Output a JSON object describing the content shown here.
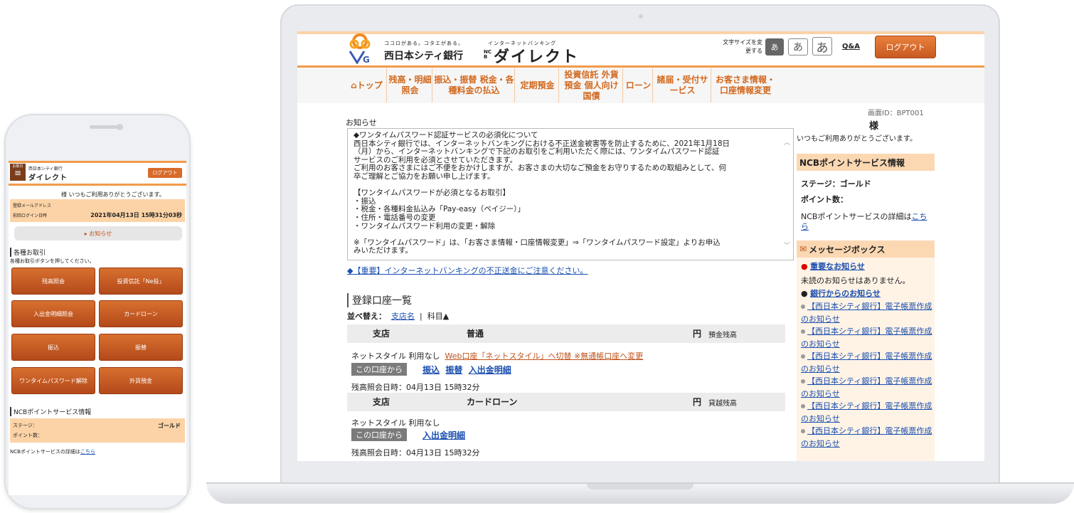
{
  "phone": {
    "logo_small": "西日本シティ銀行",
    "logo_main": "ダイレクト",
    "menu_label": "お取引",
    "logout": "ログアウト",
    "greeting": "様 いつもご利用ありがとうございます。",
    "email_label": "登録メールアドレス",
    "last_login_label": "前回ログイン日時",
    "last_login_value": "2021年04月13日 15時31分03秒",
    "notice_btn": "お知らせ",
    "section_title": "各種お取引",
    "section_sub": "各種お取引ボタンを押してください。",
    "buttons": [
      "残高照会",
      "投資信託「Ne投」",
      "入出金明細照会",
      "カードローン",
      "振込",
      "振替",
      "ワンタイムパスワード解除",
      "外貨預金"
    ],
    "ncb_title": "NCBポイントサービス情報",
    "stage_label": "ステージ：",
    "stage_value": "ゴールド",
    "points_label": "ポイント数：",
    "ncb_detail": "NCBポイントサービスの詳細は",
    "ncb_link": "こちら"
  },
  "desktop": {
    "tagline": "ココロがある。コタエがある。",
    "tagline2": "インターネットバンキング",
    "bank_name": "西日本シティ銀行",
    "ncb": "NCB",
    "direct": "ダイレクト",
    "font_size_label": "文字サイズを変更する",
    "font_a1": "あ",
    "font_a2": "あ",
    "font_a3": "あ",
    "qa": "Q&A",
    "logout": "ログアウト",
    "nav": [
      "トップ",
      "残高・明細照会",
      "振込・振替 税金・各種料金の払込",
      "定期預金",
      "投資信託 外貨預金 個人向け国債",
      "ローン",
      "諸届・受付サービス",
      "お客さま情報・口座情報変更"
    ],
    "screen_id": "画面ID：BPT001",
    "sama": "様",
    "thanks": "いつもご利用ありがとうございます。",
    "notice_label": "お知らせ",
    "notice_lines": [
      "◆ワンタイムパスワード認証サービスの必須化について",
      "西日本シティ銀行では、インターネットバンキングにおける不正送金被害等を防止するために、2021年1月18日",
      "（月）から、インターネットバンキングで下記のお取引をご利用いただく際には、ワンタイムパスワード認証",
      "サービスのご利用を必須とさせていただきます。",
      "ご利用のお客さまにはご不便をおかけしますが、お客さまの大切なご預金をお守りするための取組みとして、何",
      "卒ご理解とご協力をお願い申し上げます。",
      "",
      "【ワンタイムパスワードが必須となるお取引】",
      "・振込",
      "・税金・各種料金払込み「Pay-easy（ペイジー）」",
      "・住所・電話番号の変更",
      "・ワンタイムパスワード利用の変更・解除",
      "",
      "※「ワンタイムパスワード」は、「お客さま情報・口座情報変更」⇒「ワンタイムパスワード設定」よりお申込",
      "みいただけます。"
    ],
    "important_link": "◆【重要】インターネットバンキングの不正送金にご注意ください。",
    "accounts_title": "登録口座一覧",
    "sort_label": "並べ替え：",
    "sort_branch": "支店名",
    "sort_type": "科目▲",
    "accounts": [
      {
        "branch": "支店",
        "type": "普通",
        "yen": "円",
        "bal_label": "預金残高",
        "line1": "ネットスタイル 利用なし",
        "web_link": "Web口座「ネットスタイル」へ切替 ※無通帳口座へ変更",
        "tag": "この口座から",
        "actions": [
          "振込",
          "振替",
          "入出金明細"
        ],
        "time": "残高照会日時：04月13日 15時32分"
      },
      {
        "branch": "支店",
        "type": "カードローン",
        "yen": "円",
        "bal_label": "貸越残高",
        "line1": "ネットスタイル 利用なし",
        "web_link": "",
        "tag": "この口座から",
        "actions": [
          "入出金明細"
        ],
        "time": "残高照会日時：04月13日 15時32分"
      }
    ],
    "ncb_title": "NCBポイントサービス情報",
    "stage_label": "ステージ：ゴールド",
    "points_label": "ポイント数：",
    "ncb_detail": "NCBポイントサービスの詳細は",
    "ncb_link1": "こち",
    "ncb_link2": "ら",
    "msg_title": "メッセージボックス",
    "important_notice": "重要なお知らせ",
    "no_unread": "未読のお知らせはありません。",
    "bank_notice": "銀行からのお知らせ",
    "notices": [
      "【西日本シティ銀行】電子帳票作成",
      "【西日本シティ銀行】電子帳票作成",
      "【西日本シティ銀行】電子帳票作成",
      "【西日本シティ銀行】電子帳票作成",
      "【西日本シティ銀行】電子帳票作成",
      "【西日本シティ銀行】電子帳票作成"
    ],
    "notice_suffix": "のお知らせ"
  }
}
